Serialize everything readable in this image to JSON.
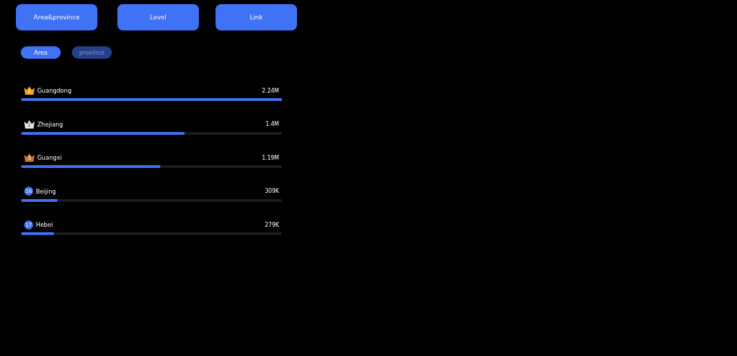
{
  "tabs": [
    {
      "label": "Area&province",
      "selected": false
    },
    {
      "label": "Level",
      "selected": false
    },
    {
      "label": "Link",
      "selected": false
    }
  ],
  "toggles": [
    {
      "label": "Area",
      "selected": true
    },
    {
      "label": "province",
      "selected": false
    }
  ],
  "rows": [
    {
      "kind": "crown",
      "rank": "1",
      "color": "#f5a623",
      "name": "Guangdong",
      "value": "2.24M",
      "level": 1
    },
    {
      "kind": "crown",
      "rank": "2",
      "color": "#dde2ea",
      "name": "Zhejiang",
      "value": "1.4M",
      "level": 0.626
    },
    {
      "kind": "crown",
      "rank": "3",
      "color": "#c47a3e",
      "name": "Guangxi",
      "value": "1.19M",
      "level": 0.532
    },
    {
      "kind": "badge",
      "rank": "16",
      "name": "Beijing",
      "value": "309K",
      "level": 0.138
    },
    {
      "kind": "badge",
      "rank": "17",
      "name": "Hebei",
      "value": "279K",
      "level": 0.125
    }
  ]
}
